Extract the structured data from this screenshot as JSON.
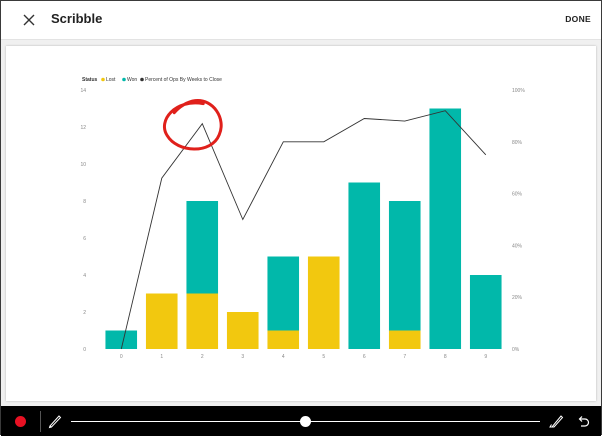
{
  "header": {
    "title": "Scribble",
    "done_label": "DONE"
  },
  "icons": {
    "close": "close-icon",
    "record": "record-dot-icon",
    "pen": "pen-icon",
    "eraser": "eraser-icon",
    "undo": "undo-icon"
  },
  "colors": {
    "lost": "#f2c80f",
    "won": "#01b8aa",
    "line": "#333333",
    "scribble": "#e0201b",
    "record": "#e81123"
  },
  "slider": {
    "value_fraction": 0.5
  },
  "chart_data": {
    "type": "bar",
    "stacked": true,
    "legend_title": "Status",
    "legend_position": "top-left",
    "categories": [
      "0",
      "1",
      "2",
      "3",
      "4",
      "5",
      "6",
      "7",
      "8",
      "9"
    ],
    "series": [
      {
        "name": "Lost",
        "values": [
          0,
          3,
          3,
          2,
          1,
          5,
          0,
          1,
          0,
          0
        ]
      },
      {
        "name": "Won",
        "values": [
          1,
          0,
          5,
          0,
          4,
          0,
          9,
          7,
          13,
          4
        ]
      }
    ],
    "line_series": {
      "name": "Percent of Ops By Weeks to Close",
      "axis": "right",
      "values": [
        0,
        66,
        87,
        50,
        80,
        80,
        89,
        88,
        92,
        75
      ]
    },
    "y_left": {
      "ylim": [
        0,
        14
      ],
      "ticks": [
        "0",
        "2",
        "4",
        "6",
        "8",
        "10",
        "12",
        "14"
      ]
    },
    "y_right": {
      "ylim": [
        0,
        100
      ],
      "ticks": [
        "0%",
        "20%",
        "40%",
        "60%",
        "80%",
        "100%"
      ]
    },
    "grid": false
  }
}
